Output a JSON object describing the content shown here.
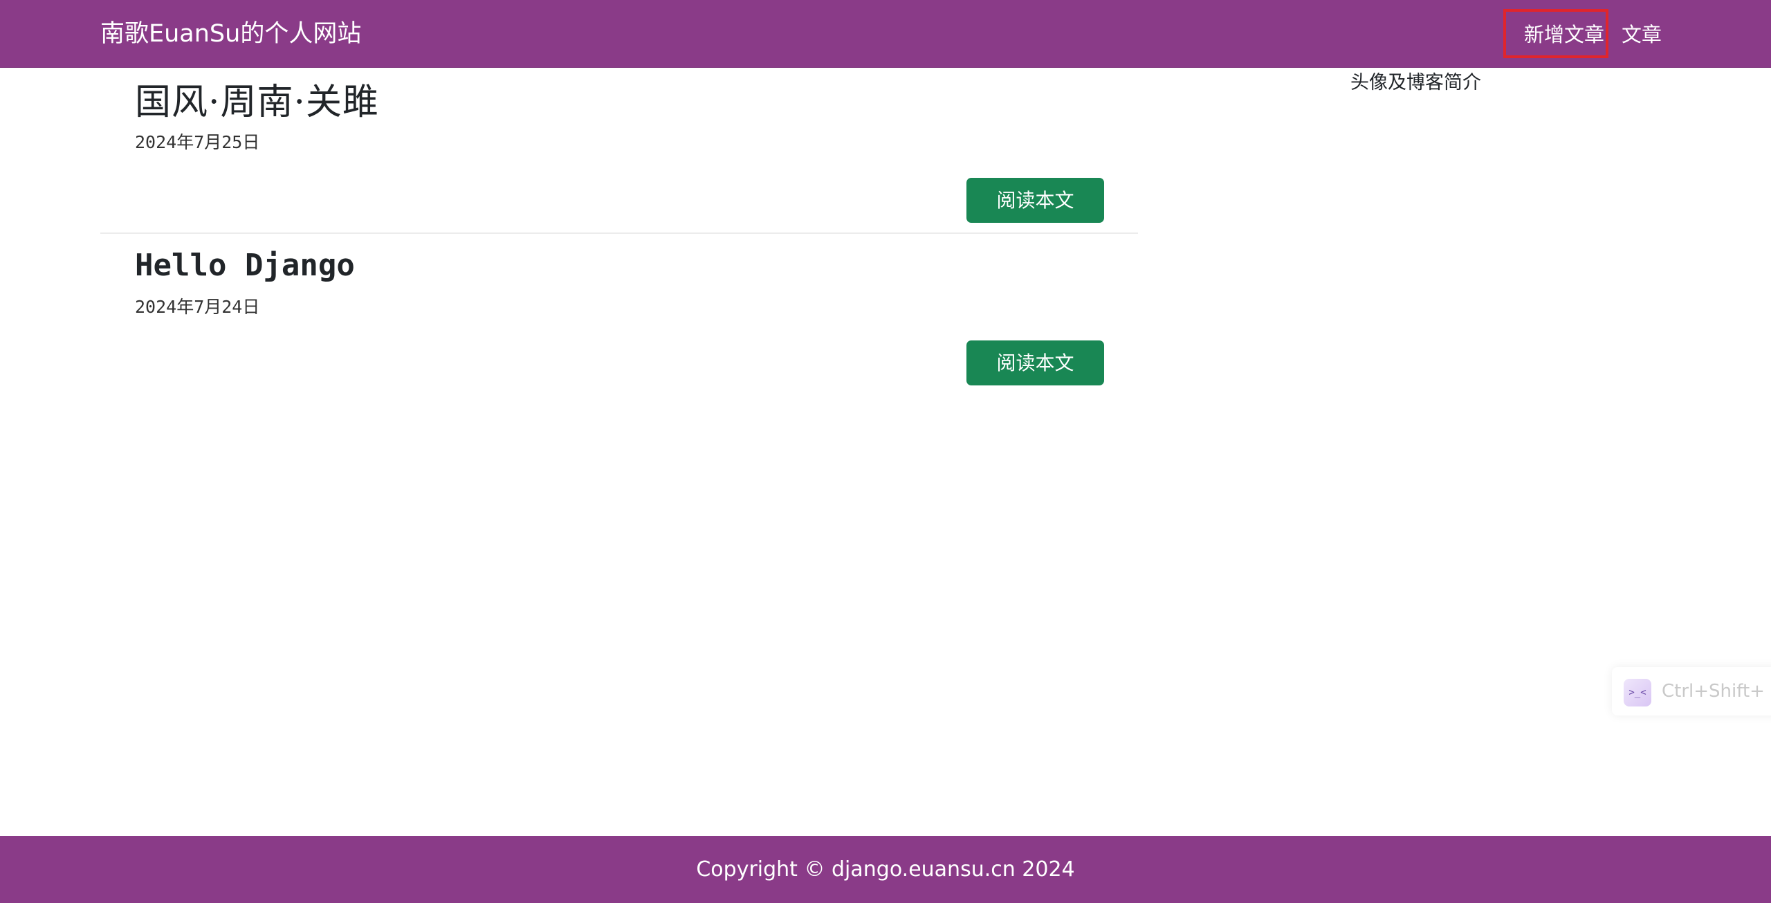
{
  "navbar": {
    "brand": "南歌EuanSu的个人网站",
    "links": [
      {
        "label": "新增文章"
      },
      {
        "label": "文章"
      }
    ]
  },
  "posts": [
    {
      "title": "国风·周南·关雎",
      "date": "2024年7月25日",
      "button_label": "阅读本文"
    },
    {
      "title": "Hello Django",
      "date": "2024年7月24日",
      "button_label": "阅读本文"
    }
  ],
  "sidebar": {
    "intro": "头像及博客简介"
  },
  "shortcut_hint": {
    "icon": "command-icon",
    "text": "Ctrl+Shift+"
  },
  "footer": {
    "copyright": "Copyright © django.euansu.cn 2024"
  },
  "colors": {
    "navbar_bg": "#8a3b88",
    "button_bg": "#198754",
    "highlight_border": "#e0252c"
  }
}
